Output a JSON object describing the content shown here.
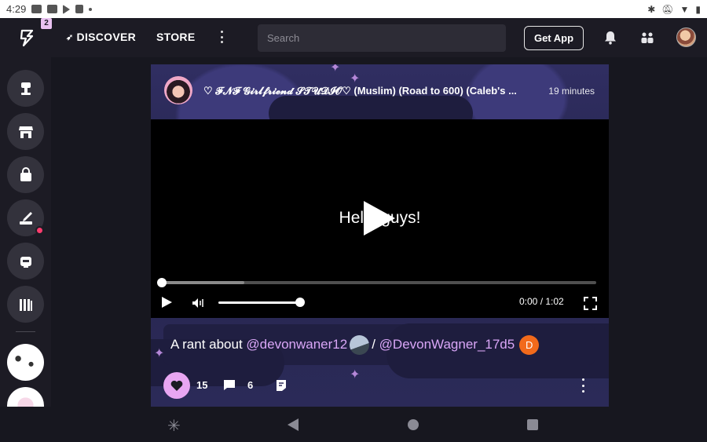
{
  "status_bar": {
    "time": "4:29"
  },
  "topbar": {
    "notification_count": "2",
    "discover_label": "DISCOVER",
    "store_label": "STORE",
    "search_placeholder": "Search",
    "get_app_label": "Get App"
  },
  "post": {
    "title": "♡ 𝓕𝓝𝓕 𝓖𝓲𝓻𝓵𝓯𝓻𝓲𝓮𝓷𝓭 𝓢𝓣𝓤𝓓𝓘𝓞♡ (Muslim) (Road to 600) (Caleb's ...",
    "time": "19 minutes",
    "video_caption": "Hello guys!",
    "video_time": "0:00 / 1:02",
    "progress_fraction": 0.0,
    "buffered_fraction": 0.19,
    "volume_fraction": 1.0,
    "caption_prefix": "A rant about ",
    "mention_1": "@devonwaner12",
    "separator": "/ ",
    "mention_2": "@DevonWagner_17d5",
    "mention_2_avatar_letter": "D",
    "likes": "15",
    "comments": "6"
  },
  "colors": {
    "accent": "#e8a6f2",
    "mention": "#d9a6f7",
    "notification_dot": "#ff3d6e",
    "topbar_bg": "#1c1b24",
    "page_bg": "#17171f"
  },
  "icons": {
    "logo": "lightning-bolt-icon",
    "bell": "bell-icon",
    "people": "add-people-icon",
    "play": "play-icon",
    "volume": "volume-icon",
    "fullscreen": "fullscreen-icon",
    "like": "heart-icon",
    "comment": "comment-icon",
    "repost": "repost-icon",
    "more": "more-vertical-icon"
  }
}
